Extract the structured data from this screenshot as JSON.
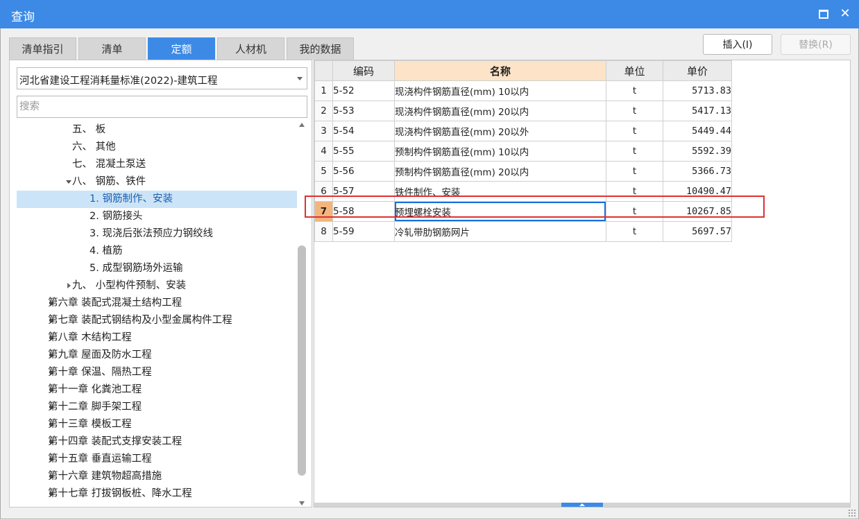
{
  "window": {
    "title": "查询"
  },
  "tabs": [
    {
      "label": "清单指引",
      "active": false
    },
    {
      "label": "清单",
      "active": false
    },
    {
      "label": "定额",
      "active": true
    },
    {
      "label": "人材机",
      "active": false
    },
    {
      "label": "我的数据",
      "active": false
    }
  ],
  "buttons": {
    "insert": "插入(I)",
    "replace": "替换(R)"
  },
  "left": {
    "library": "河北省建设工程消耗量标准(2022)-建筑工程",
    "search_placeholder": "搜索",
    "tree": [
      {
        "label": "五、 板",
        "level": 2,
        "caret": "none",
        "selected": false
      },
      {
        "label": "六、 其他",
        "level": 2,
        "caret": "none",
        "selected": false
      },
      {
        "label": "七、 混凝土泵送",
        "level": 2,
        "caret": "none",
        "selected": false
      },
      {
        "label": "八、 钢筋、铁件",
        "level": 2,
        "caret": "down",
        "selected": false
      },
      {
        "label": "1. 钢筋制作、安装",
        "level": 3,
        "caret": "none",
        "selected": true
      },
      {
        "label": "2. 钢筋接头",
        "level": 3,
        "caret": "none",
        "selected": false
      },
      {
        "label": "3. 现浇后张法预应力钢绞线",
        "level": 3,
        "caret": "none",
        "selected": false
      },
      {
        "label": "4. 植筋",
        "level": 3,
        "caret": "none",
        "selected": false
      },
      {
        "label": "5. 成型钢筋场外运输",
        "level": 3,
        "caret": "none",
        "selected": false
      },
      {
        "label": "九、 小型构件预制、安装",
        "level": 2,
        "caret": "right",
        "selected": false
      },
      {
        "label": "第六章 装配式混凝土结构工程",
        "level": 1,
        "caret": "right",
        "selected": false
      },
      {
        "label": "第七章 装配式钢结构及小型金属构件工程",
        "level": 1,
        "caret": "right",
        "selected": false
      },
      {
        "label": "第八章 木结构工程",
        "level": 1,
        "caret": "right",
        "selected": false
      },
      {
        "label": "第九章 屋面及防水工程",
        "level": 1,
        "caret": "right",
        "selected": false
      },
      {
        "label": "第十章 保温、隔热工程",
        "level": 1,
        "caret": "right",
        "selected": false
      },
      {
        "label": "第十一章 化粪池工程",
        "level": 1,
        "caret": "right",
        "selected": false
      },
      {
        "label": "第十二章 脚手架工程",
        "level": 1,
        "caret": "right",
        "selected": false
      },
      {
        "label": "第十三章 模板工程",
        "level": 1,
        "caret": "right",
        "selected": false
      },
      {
        "label": "第十四章 装配式支撑安装工程",
        "level": 1,
        "caret": "right",
        "selected": false
      },
      {
        "label": "第十五章 垂直运输工程",
        "level": 1,
        "caret": "right",
        "selected": false
      },
      {
        "label": "第十六章 建筑物超高措施",
        "level": 1,
        "caret": "right",
        "selected": false
      },
      {
        "label": "第十七章 打拔钢板桩、降水工程",
        "level": 1,
        "caret": "right",
        "selected": false
      }
    ]
  },
  "table": {
    "headers": {
      "code": "编码",
      "name": "名称",
      "unit": "单位",
      "price": "单价"
    },
    "rows": [
      {
        "idx": "1",
        "code": "5-52",
        "name": "现浇构件钢筋直径(mm) 10以内",
        "unit": "t",
        "price": "5713.83"
      },
      {
        "idx": "2",
        "code": "5-53",
        "name": "现浇构件钢筋直径(mm) 20以内",
        "unit": "t",
        "price": "5417.13"
      },
      {
        "idx": "3",
        "code": "5-54",
        "name": "现浇构件钢筋直径(mm) 20以外",
        "unit": "t",
        "price": "5449.44"
      },
      {
        "idx": "4",
        "code": "5-55",
        "name": "预制构件钢筋直径(mm) 10以内",
        "unit": "t",
        "price": "5592.39"
      },
      {
        "idx": "5",
        "code": "5-56",
        "name": "预制构件钢筋直径(mm) 20以内",
        "unit": "t",
        "price": "5366.73"
      },
      {
        "idx": "6",
        "code": "5-57",
        "name": "铁件制作、安装",
        "unit": "t",
        "price": "10490.47"
      },
      {
        "idx": "7",
        "code": "5-58",
        "name": "预埋螺栓安装",
        "unit": "t",
        "price": "10267.85"
      },
      {
        "idx": "8",
        "code": "5-59",
        "name": "冷轧带肋钢筋网片",
        "unit": "t",
        "price": "5697.57"
      }
    ],
    "current_row": 6
  },
  "colors": {
    "accent": "#3c8ae6",
    "highlight_box": "#e03030",
    "header_highlight": "#fde4c8",
    "current_row_index": "#f4b57c"
  }
}
